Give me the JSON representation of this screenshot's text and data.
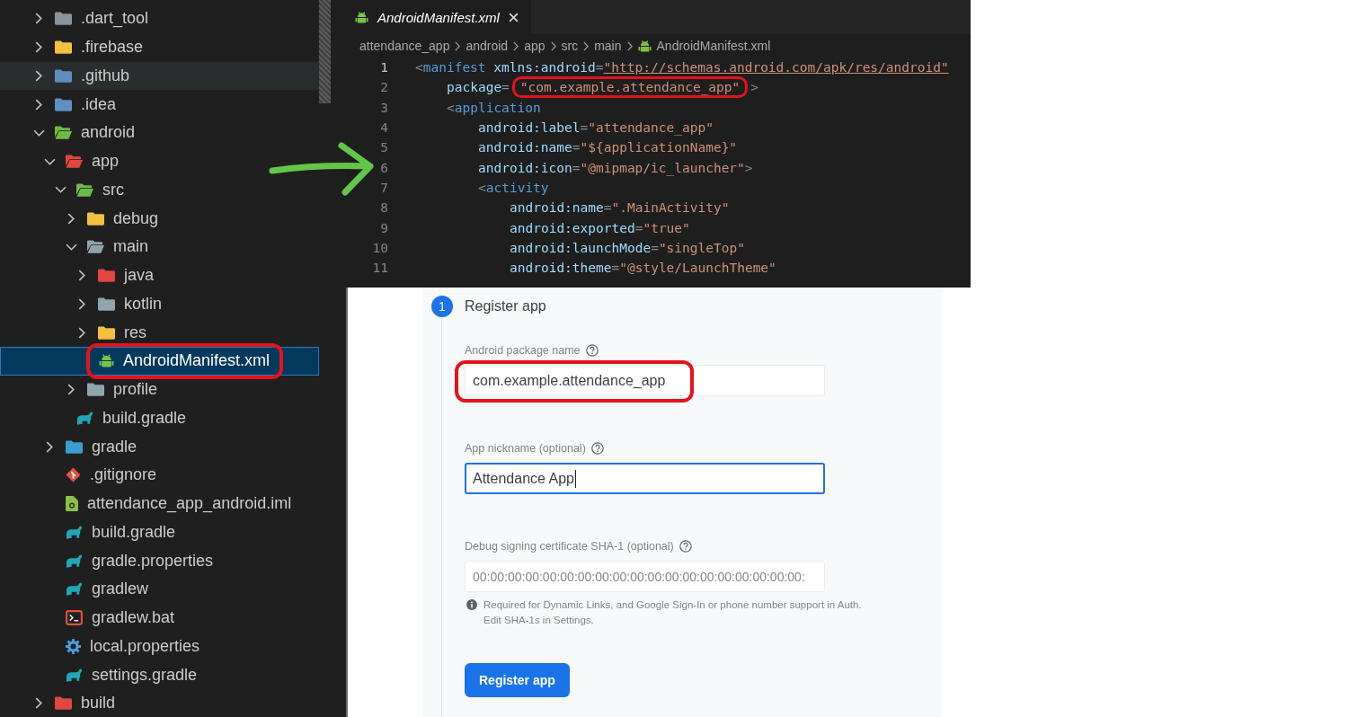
{
  "file_explorer": {
    "items": [
      {
        "label": ".dart_tool",
        "kind": "folder",
        "color": "#8c9399",
        "expanded": false,
        "selected": false,
        "hovered": false,
        "circled": false
      },
      {
        "label": ".firebase",
        "kind": "folder",
        "color": "#f4c03e",
        "expanded": false,
        "selected": false,
        "hovered": false,
        "circled": false
      },
      {
        "label": ".github",
        "kind": "folder",
        "color": "#5f8fbf",
        "expanded": false,
        "selected": false,
        "hovered": true,
        "circled": false
      },
      {
        "label": ".idea",
        "kind": "folder",
        "color": "#5f8fbf",
        "expanded": false,
        "selected": false,
        "hovered": false,
        "circled": false
      },
      {
        "label": "android",
        "kind": "folder",
        "color": "#6dbb45",
        "expanded": true,
        "selected": false,
        "hovered": false,
        "circled": false,
        "children": [
          {
            "label": "app",
            "kind": "folder",
            "color": "#e2463f",
            "expanded": true,
            "selected": false,
            "hovered": false,
            "circled": false,
            "children": [
              {
                "label": "src",
                "kind": "folder",
                "color": "#6dbb45",
                "expanded": true,
                "selected": false,
                "hovered": false,
                "circled": false,
                "children": [
                  {
                    "label": "debug",
                    "kind": "folder",
                    "color": "#f4c03e",
                    "expanded": false,
                    "selected": false,
                    "hovered": false,
                    "circled": false
                  },
                  {
                    "label": "main",
                    "kind": "folder",
                    "color": "#90a4ae",
                    "expanded": true,
                    "selected": false,
                    "hovered": false,
                    "circled": false,
                    "children": [
                      {
                        "label": "java",
                        "kind": "folder",
                        "color": "#e2463f",
                        "expanded": false,
                        "selected": false,
                        "hovered": false,
                        "circled": false
                      },
                      {
                        "label": "kotlin",
                        "kind": "folder",
                        "color": "#90a4ae",
                        "expanded": false,
                        "selected": false,
                        "hovered": false,
                        "circled": false
                      },
                      {
                        "label": "res",
                        "kind": "folder",
                        "color": "#f4c03e",
                        "expanded": false,
                        "selected": false,
                        "hovered": false,
                        "circled": false
                      },
                      {
                        "label": "AndroidManifest.xml",
                        "kind": "android",
                        "selected": true,
                        "hovered": false,
                        "circled": true
                      }
                    ]
                  },
                  {
                    "label": "profile",
                    "kind": "folder",
                    "color": "#90a4ae",
                    "expanded": false,
                    "selected": false,
                    "hovered": false,
                    "circled": false
                  }
                ]
              },
              {
                "label": "build.gradle",
                "kind": "gradle",
                "selected": false,
                "hovered": false,
                "circled": false
              }
            ]
          },
          {
            "label": "gradle",
            "kind": "folder",
            "color": "#3a9fd0",
            "expanded": false,
            "selected": false,
            "hovered": false,
            "circled": false
          },
          {
            "label": ".gitignore",
            "kind": "git",
            "selected": false,
            "hovered": false,
            "circled": false
          },
          {
            "label": "attendance_app_android.iml",
            "kind": "iml",
            "selected": false,
            "hovered": false,
            "circled": false
          },
          {
            "label": "build.gradle",
            "kind": "gradle",
            "selected": false,
            "hovered": false,
            "circled": false
          },
          {
            "label": "gradle.properties",
            "kind": "gradle",
            "selected": false,
            "hovered": false,
            "circled": false
          },
          {
            "label": "gradlew",
            "kind": "gradle",
            "selected": false,
            "hovered": false,
            "circled": false
          },
          {
            "label": "gradlew.bat",
            "kind": "terminal",
            "selected": false,
            "hovered": false,
            "circled": false
          },
          {
            "label": "local.properties",
            "kind": "gear",
            "selected": false,
            "hovered": false,
            "circled": false
          },
          {
            "label": "settings.gradle",
            "kind": "gradle",
            "selected": false,
            "hovered": false,
            "circled": false
          }
        ]
      },
      {
        "label": "build",
        "kind": "folder",
        "color": "#e2463f",
        "expanded": false,
        "selected": false,
        "hovered": false,
        "circled": false
      }
    ]
  },
  "editor": {
    "tabs": [
      {
        "label": "AndroidManifest.xml",
        "selected": true,
        "preview": true
      }
    ],
    "breadcrumb": [
      {
        "label": "attendance_app",
        "kind": "folder"
      },
      {
        "label": "android",
        "kind": "folder"
      },
      {
        "label": "app",
        "kind": "folder"
      },
      {
        "label": "src",
        "kind": "folder"
      },
      {
        "label": "main",
        "kind": "folder"
      },
      {
        "label": "AndroidManifest.xml",
        "kind": "android"
      }
    ],
    "lines": [
      {
        "number": "1",
        "current": true,
        "tokens": [
          {
            "kind": "punct",
            "text": "<"
          },
          {
            "kind": "tag",
            "text": "manifest "
          },
          {
            "kind": "attr",
            "text": "xmlns:android"
          },
          {
            "kind": "punct",
            "text": "="
          },
          {
            "kind": "url",
            "text": "\"http://schemas.android.com/apk/res/android\""
          }
        ],
        "children": [
          {
            "number": "2",
            "current": false,
            "tokens": [
              {
                "kind": "attr",
                "text": "package"
              },
              {
                "kind": "punct",
                "text": "="
              },
              {
                "kind": "circled",
                "text": "\"com.example.attendance_app\""
              },
              {
                "kind": "punct",
                "text": ">"
              }
            ]
          },
          {
            "number": "3",
            "current": false,
            "tokens": [
              {
                "kind": "punct",
                "text": "<"
              },
              {
                "kind": "tag",
                "text": "application"
              }
            ],
            "children": [
              {
                "number": "4",
                "current": false,
                "tokens": [
                  {
                    "kind": "attr",
                    "text": "android:label"
                  },
                  {
                    "kind": "punct",
                    "text": "="
                  },
                  {
                    "kind": "string",
                    "text": "\"attendance_app\""
                  }
                ]
              },
              {
                "number": "5",
                "current": false,
                "tokens": [
                  {
                    "kind": "attr",
                    "text": "android:name"
                  },
                  {
                    "kind": "punct",
                    "text": "="
                  },
                  {
                    "kind": "string",
                    "text": "\"${applicationName}\""
                  }
                ]
              },
              {
                "number": "6",
                "current": false,
                "tokens": [
                  {
                    "kind": "attr",
                    "text": "android:icon"
                  },
                  {
                    "kind": "punct",
                    "text": "="
                  },
                  {
                    "kind": "string",
                    "text": "\"@mipmap/ic_launcher\""
                  },
                  {
                    "kind": "punct",
                    "text": ">"
                  }
                ]
              },
              {
                "number": "7",
                "current": false,
                "tokens": [
                  {
                    "kind": "punct",
                    "text": "<"
                  },
                  {
                    "kind": "tag",
                    "text": "activity"
                  }
                ],
                "children": [
                  {
                    "number": "8",
                    "current": false,
                    "tokens": [
                      {
                        "kind": "attr",
                        "text": "android:name"
                      },
                      {
                        "kind": "punct",
                        "text": "="
                      },
                      {
                        "kind": "string",
                        "text": "\".MainActivity\""
                      }
                    ]
                  },
                  {
                    "number": "9",
                    "current": false,
                    "tokens": [
                      {
                        "kind": "attr",
                        "text": "android:exported"
                      },
                      {
                        "kind": "punct",
                        "text": "="
                      },
                      {
                        "kind": "string",
                        "text": "\"true\""
                      }
                    ]
                  },
                  {
                    "number": "10",
                    "current": false,
                    "tokens": [
                      {
                        "kind": "attr",
                        "text": "android:launchMode"
                      },
                      {
                        "kind": "punct",
                        "text": "="
                      },
                      {
                        "kind": "string",
                        "text": "\"singleTop\""
                      }
                    ]
                  },
                  {
                    "number": "11",
                    "current": false,
                    "tokens": [
                      {
                        "kind": "attr",
                        "text": "android:theme"
                      },
                      {
                        "kind": "punct",
                        "text": "="
                      },
                      {
                        "kind": "string",
                        "text": "\"@style/LaunchTheme\""
                      }
                    ]
                  }
                ]
              }
            ]
          }
        ]
      }
    ]
  },
  "annotations": {
    "arrow": true
  },
  "register_app": {
    "step": "1",
    "title": "Register app",
    "fields": [
      {
        "label": "Android package name",
        "value": "com.example.attendance_app",
        "focused": false,
        "circled": true
      },
      {
        "label": "App nickname (optional)",
        "value": "Attendance App",
        "focused": true,
        "circled": false
      },
      {
        "label": "Debug signing certificate SHA-1 (optional)",
        "placeholder": "00:00:00:00:00:00:00:00:00:00:00:00:00:00:00:00:00:00:00:",
        "focused": false,
        "circled": false
      }
    ],
    "note": [
      "Required for Dynamic Links, and Google Sign-In or phone number support in Auth.",
      "Edit SHA-1s in Settings."
    ],
    "button": "Register app"
  }
}
